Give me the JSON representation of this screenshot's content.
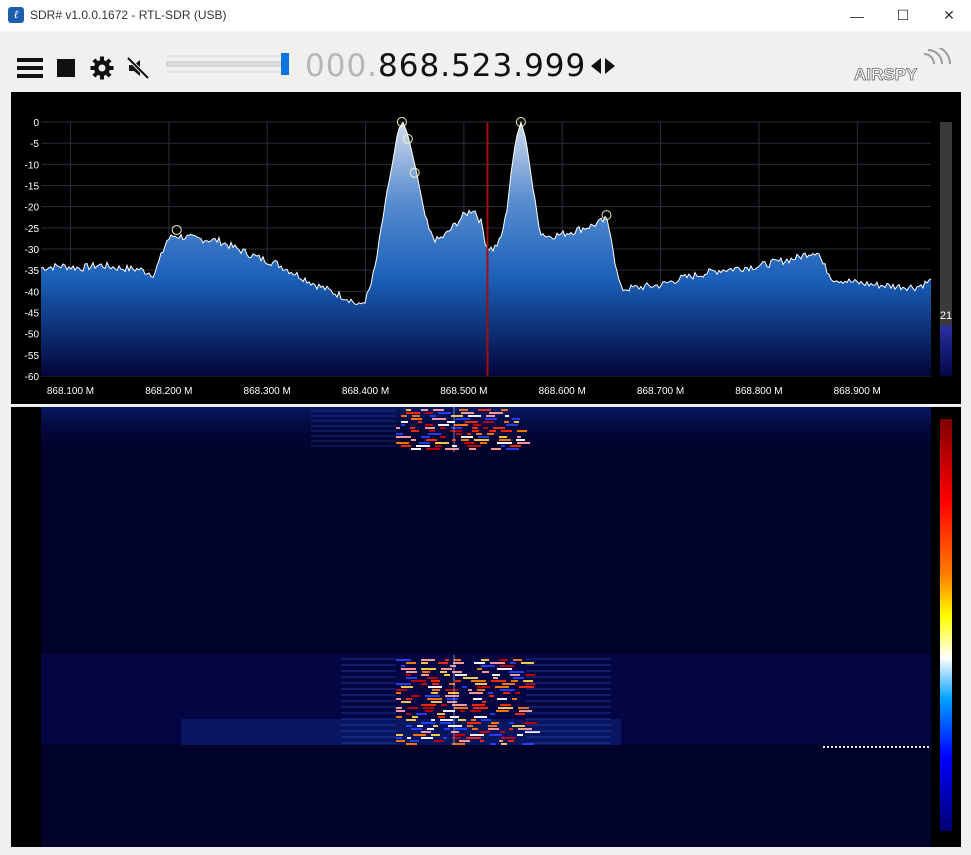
{
  "window": {
    "title": "SDR# v1.0.0.1672 - RTL-SDR (USB)",
    "minimize_glyph": "—",
    "maximize_glyph": "☐",
    "close_glyph": "✕"
  },
  "toolbar": {
    "menu_icon": "hamburger-menu-icon",
    "stop_icon": "stop-icon",
    "settings_icon": "gear-icon",
    "mute_icon": "speaker-muted-icon",
    "volume_level": 0.95,
    "frequency_prefix": "000.",
    "frequency_main": "868.523.999",
    "tuning_arrows_icon": "left-right-arrows-icon",
    "logo_text": "AIRSPY"
  },
  "spectrum": {
    "y_ticks": [
      "0",
      "-5",
      "-10",
      "-15",
      "-20",
      "-25",
      "-30",
      "-35",
      "-40",
      "-45",
      "-50",
      "-55",
      "-60"
    ],
    "x_ticks": [
      "868.100 M",
      "868.200 M",
      "868.300 M",
      "868.400 M",
      "868.500 M",
      "868.600 M",
      "868.700 M",
      "868.800 M",
      "868.900 M"
    ],
    "x_tick_values": [
      868.1,
      868.2,
      868.3,
      868.4,
      868.5,
      868.6,
      868.7,
      868.8,
      868.9
    ],
    "x_range": [
      868.07,
      868.975
    ],
    "y_range": [
      -60,
      0
    ],
    "center_frequency": 868.524,
    "gain_value": "21",
    "gain_level": 0.18,
    "profile": [
      [
        868.07,
        -34.5
      ],
      [
        868.09,
        -34
      ],
      [
        868.11,
        -34.5
      ],
      [
        868.13,
        -33.8
      ],
      [
        868.15,
        -34.5
      ],
      [
        868.17,
        -34.8
      ],
      [
        868.185,
        -36
      ],
      [
        868.19,
        -33
      ],
      [
        868.198,
        -28
      ],
      [
        868.205,
        -26.8
      ],
      [
        868.225,
        -27.5
      ],
      [
        868.25,
        -28
      ],
      [
        868.27,
        -30
      ],
      [
        868.29,
        -32
      ],
      [
        868.31,
        -33.5
      ],
      [
        868.33,
        -36
      ],
      [
        868.35,
        -38.5
      ],
      [
        868.37,
        -40.5
      ],
      [
        868.385,
        -42
      ],
      [
        868.393,
        -43.5
      ],
      [
        868.4,
        -42
      ],
      [
        868.405,
        -39
      ],
      [
        868.41,
        -34
      ],
      [
        868.415,
        -27
      ],
      [
        868.42,
        -19
      ],
      [
        868.428,
        -9
      ],
      [
        868.433,
        -2
      ],
      [
        868.438,
        0
      ],
      [
        868.443,
        -3
      ],
      [
        868.448,
        -8
      ],
      [
        868.453,
        -13
      ],
      [
        868.458,
        -20
      ],
      [
        868.465,
        -26
      ],
      [
        868.472,
        -28
      ],
      [
        868.48,
        -27
      ],
      [
        868.49,
        -24.5
      ],
      [
        868.5,
        -22
      ],
      [
        868.51,
        -20.5
      ],
      [
        868.518,
        -24
      ],
      [
        868.523,
        -29.5
      ],
      [
        868.53,
        -30
      ],
      [
        868.537,
        -28
      ],
      [
        868.543,
        -22
      ],
      [
        868.548,
        -12
      ],
      [
        868.553,
        -4
      ],
      [
        868.558,
        0
      ],
      [
        868.563,
        -4
      ],
      [
        868.568,
        -12
      ],
      [
        868.573,
        -20
      ],
      [
        868.578,
        -26
      ],
      [
        868.585,
        -27
      ],
      [
        868.6,
        -26.5
      ],
      [
        868.615,
        -25.5
      ],
      [
        868.63,
        -24.5
      ],
      [
        868.645,
        -23
      ],
      [
        868.65,
        -27
      ],
      [
        868.655,
        -35
      ],
      [
        868.66,
        -39.5
      ],
      [
        868.68,
        -39
      ],
      [
        868.7,
        -38.5
      ],
      [
        868.72,
        -37
      ],
      [
        868.74,
        -36
      ],
      [
        868.76,
        -35
      ],
      [
        868.78,
        -34.5
      ],
      [
        868.8,
        -34
      ],
      [
        868.82,
        -33
      ],
      [
        868.84,
        -32
      ],
      [
        868.85,
        -31
      ],
      [
        868.86,
        -30.5
      ],
      [
        868.865,
        -33.5
      ],
      [
        868.875,
        -37
      ],
      [
        868.9,
        -38
      ],
      [
        868.92,
        -38.5
      ],
      [
        868.94,
        -38.8
      ],
      [
        868.96,
        -39
      ],
      [
        868.975,
        -37.5
      ]
    ],
    "peak_markers": [
      [
        868.208,
        -25.5
      ],
      [
        868.437,
        0
      ],
      [
        868.443,
        -4
      ],
      [
        868.45,
        -12
      ],
      [
        868.558,
        0
      ],
      [
        868.645,
        -22
      ]
    ]
  },
  "waterfall": {
    "palette": [
      "#000080",
      "#0000ff",
      "#00a0ff",
      "#ffffff",
      "#ffff00",
      "#ff8000",
      "#ff0000",
      "#800000"
    ]
  }
}
